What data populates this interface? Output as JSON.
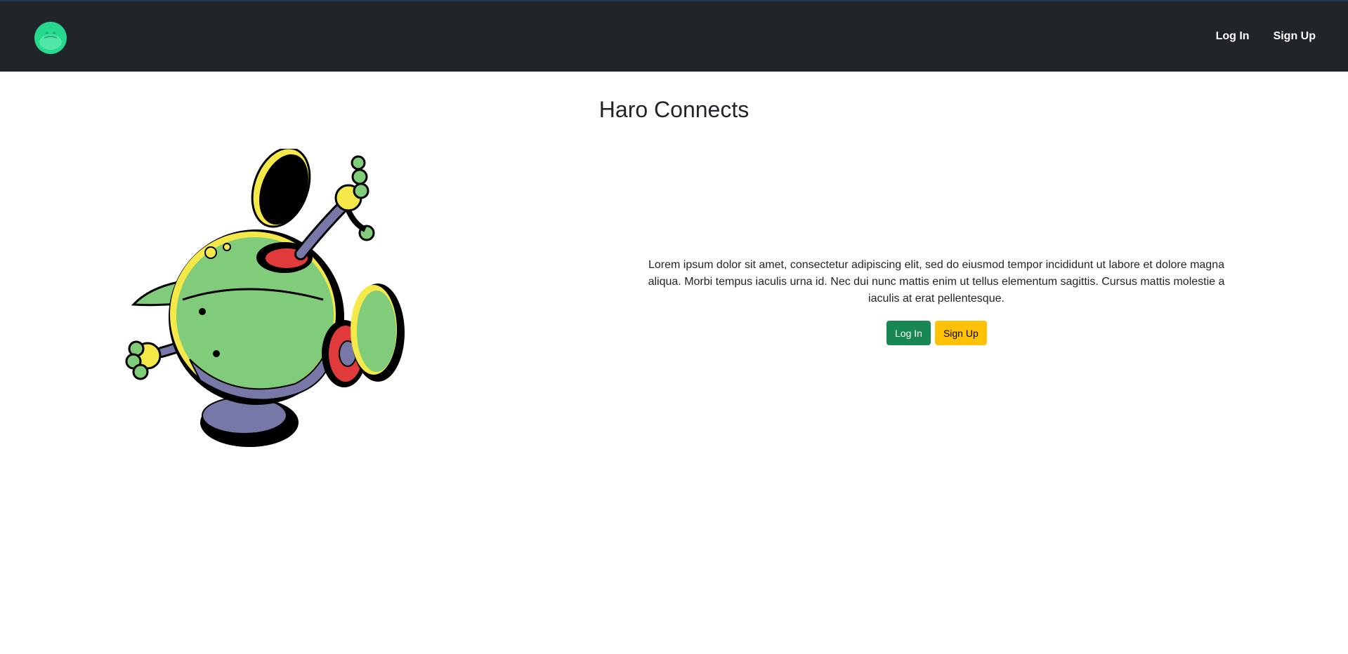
{
  "navbar": {
    "logo_icon": "haro-logo-icon",
    "login_label": "Log In",
    "signup_label": "Sign Up",
    "background": "#212529"
  },
  "main": {
    "title": "Haro Connects",
    "hero_image": "haro-robot-illustration",
    "description": "Lorem ipsum dolor sit amet, consectetur adipiscing elit, sed do eiusmod tempor incididunt ut labore et dolore magna aliqua. Morbi tempus iaculis urna id. Nec dui nunc mattis enim ut tellus elementum sagittis. Cursus mattis molestie a iaculis at erat pellentesque.",
    "login_button": "Log In",
    "signup_button": "Sign Up"
  },
  "colors": {
    "success": "#198754",
    "warning": "#ffc107",
    "haro_green": "#80cc7a",
    "haro_purple": "#7778a8",
    "haro_red": "#e03a3a",
    "haro_yellow": "#f5e94a"
  }
}
